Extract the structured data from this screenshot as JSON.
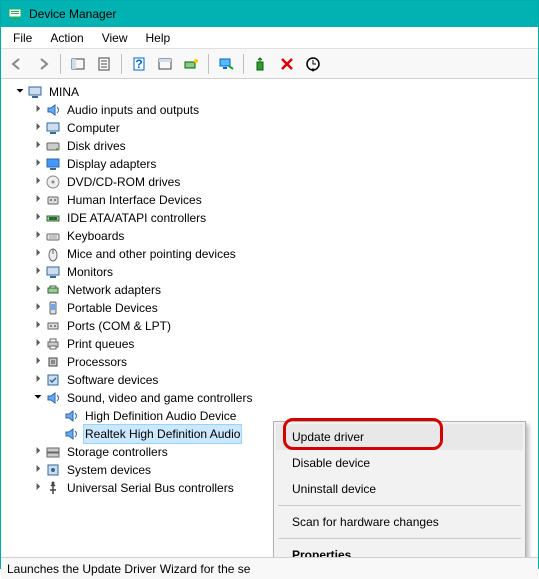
{
  "window": {
    "title": "Device Manager"
  },
  "menu": {
    "file": "File",
    "action": "Action",
    "view": "View",
    "help": "Help"
  },
  "toolbar_icons": [
    "back",
    "forward",
    "show-containers",
    "properties",
    "help",
    "refresh",
    "legacy-hw",
    "remote",
    "update-driver",
    "uninstall",
    "scan"
  ],
  "tree": {
    "root": "MINA",
    "items": [
      {
        "label": "Audio inputs and outputs",
        "icon": "speaker-icon"
      },
      {
        "label": "Computer",
        "icon": "monitor-icon"
      },
      {
        "label": "Disk drives",
        "icon": "disk-icon"
      },
      {
        "label": "Display adapters",
        "icon": "display-icon"
      },
      {
        "label": "DVD/CD-ROM drives",
        "icon": "disc-icon"
      },
      {
        "label": "Human Interface Devices",
        "icon": "hid-icon"
      },
      {
        "label": "IDE ATA/ATAPI controllers",
        "icon": "ide-icon"
      },
      {
        "label": "Keyboards",
        "icon": "keyboard-icon"
      },
      {
        "label": "Mice and other pointing devices",
        "icon": "mouse-icon"
      },
      {
        "label": "Monitors",
        "icon": "monitor-icon"
      },
      {
        "label": "Network adapters",
        "icon": "network-icon"
      },
      {
        "label": "Portable Devices",
        "icon": "portable-icon"
      },
      {
        "label": "Ports (COM & LPT)",
        "icon": "port-icon"
      },
      {
        "label": "Print queues",
        "icon": "printer-icon"
      },
      {
        "label": "Processors",
        "icon": "cpu-icon"
      },
      {
        "label": "Software devices",
        "icon": "software-icon"
      },
      {
        "label": "Sound, video and game controllers",
        "icon": "sound-icon",
        "open": true,
        "children": [
          {
            "label": "High Definition Audio Device",
            "icon": "speaker-icon"
          },
          {
            "label": "Realtek High Definition Audio",
            "icon": "speaker-icon",
            "selected": true
          }
        ]
      },
      {
        "label": "Storage controllers",
        "icon": "storage-icon"
      },
      {
        "label": "System devices",
        "icon": "system-icon"
      },
      {
        "label": "Universal Serial Bus controllers",
        "icon": "usb-icon"
      }
    ]
  },
  "context": {
    "update": "Update driver",
    "disable": "Disable device",
    "uninstall": "Uninstall device",
    "scan": "Scan for hardware changes",
    "properties": "Properties"
  },
  "status": "Launches the Update Driver Wizard for the se"
}
